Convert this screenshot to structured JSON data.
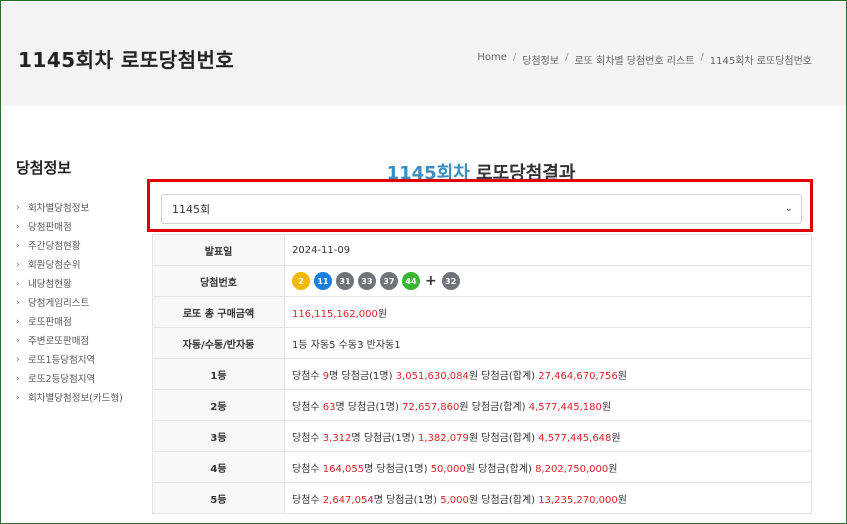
{
  "page": {
    "title": "1145회차 로또당첨번호"
  },
  "breadcrumb": [
    "Home",
    "당첨정보",
    "로또 회차별 당첨번호 리스트",
    "1145회차 로또당첨번호"
  ],
  "sidebar": {
    "title": "당첨정보",
    "items": [
      "회차별당첨정보",
      "당첨판매점",
      "주간당첨현황",
      "회원당첨순위",
      "내당첨현황",
      "당첨게임리스트",
      "로또판매점",
      "주변로또판매점",
      "로또1등당첨지역",
      "로또2등당첨지역",
      "회차별당첨정보(카드형)"
    ]
  },
  "result": {
    "title_accent": "1145회차",
    "title_rest": " 로또당첨결과"
  },
  "round_select": {
    "value": "1145회"
  },
  "info": {
    "date_label": "발표일",
    "date": "2024-11-09",
    "numbers_label": "당첨번호",
    "numbers": [
      {
        "n": "2",
        "color": "#f5b800"
      },
      {
        "n": "11",
        "color": "#1a7fe0"
      },
      {
        "n": "31",
        "color": "#6e7479"
      },
      {
        "n": "33",
        "color": "#6e7479"
      },
      {
        "n": "37",
        "color": "#6e7479"
      },
      {
        "n": "44",
        "color": "#3cb433"
      }
    ],
    "plus": "+",
    "bonus": {
      "n": "32",
      "color": "#6e7479"
    },
    "sales_label": "로또 총 구매금액",
    "sales_value": "116,115,162,000",
    "sales_unit": "원",
    "auto_label": "자동/수동/반자동",
    "auto_value": "1등 자동5 수동3 반자동1"
  },
  "prizes": [
    {
      "rank": "1등",
      "count": "9",
      "per": "3,051,630,084",
      "total": "27,464,670,756"
    },
    {
      "rank": "2등",
      "count": "63",
      "per": "72,657,860",
      "total": "4,577,445,180"
    },
    {
      "rank": "3등",
      "count": "3,312",
      "per": "1,382,079",
      "total": "4,577,445,648"
    },
    {
      "rank": "4등",
      "count": "164,055",
      "per": "50,000",
      "total": "8,202,750,000"
    },
    {
      "rank": "5등",
      "count": "2,647,054",
      "per": "5,000",
      "total": "13,235,270,000"
    }
  ],
  "prize_text": {
    "count_label": "당첨수 ",
    "count_unit": "명 ",
    "per_label": "당첨금(1명) ",
    "won": "원 ",
    "total_label": "당첨금(합계) ",
    "won_end": "원"
  },
  "icons": {
    "caret": "chevron-down-icon",
    "chev": "chevron-right-icon"
  }
}
